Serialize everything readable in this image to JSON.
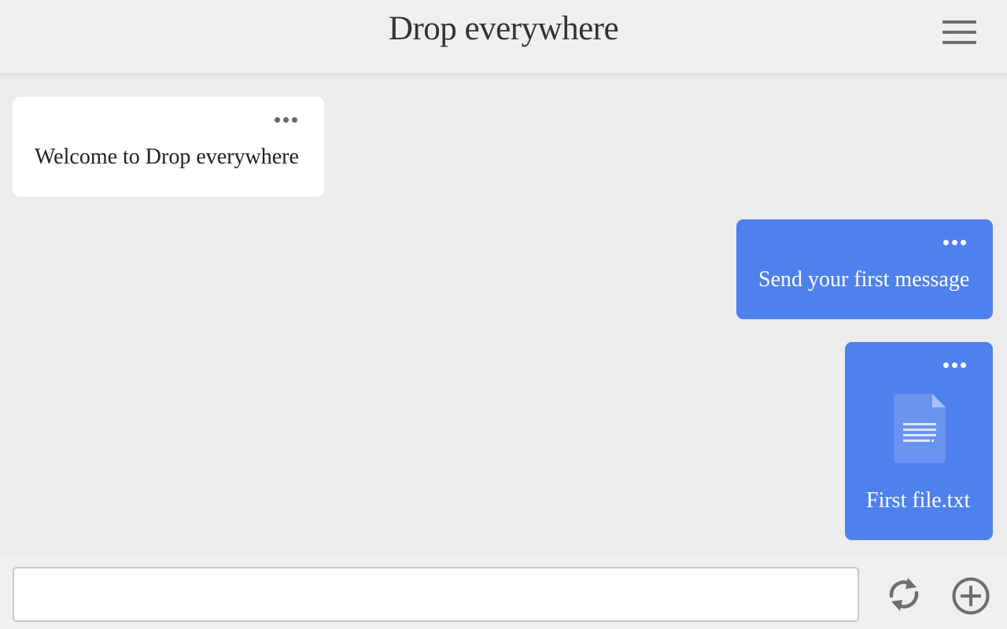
{
  "app": {
    "title": "Drop everywhere"
  },
  "header": {
    "menu_icon": "hamburger-menu-icon"
  },
  "messages": [
    {
      "direction": "incoming",
      "text": "Welcome to Drop everywhere",
      "options_icon": "more-horizontal-icon"
    },
    {
      "direction": "outgoing",
      "text": "Send your first message",
      "options_icon": "more-horizontal-icon"
    },
    {
      "direction": "outgoing",
      "type": "file",
      "filename": "First file.txt",
      "file_icon": "text-document-icon",
      "options_icon": "more-horizontal-icon"
    }
  ],
  "composer": {
    "input_value": "",
    "input_placeholder": "",
    "refresh_icon": "refresh-icon",
    "add_icon": "add-circle-icon"
  },
  "colors": {
    "background": "#ececec",
    "header": "#efefef",
    "outgoing_bubble": "#4f81ee",
    "incoming_bubble": "#ffffff",
    "icon_gray": "#6e6e6e"
  }
}
